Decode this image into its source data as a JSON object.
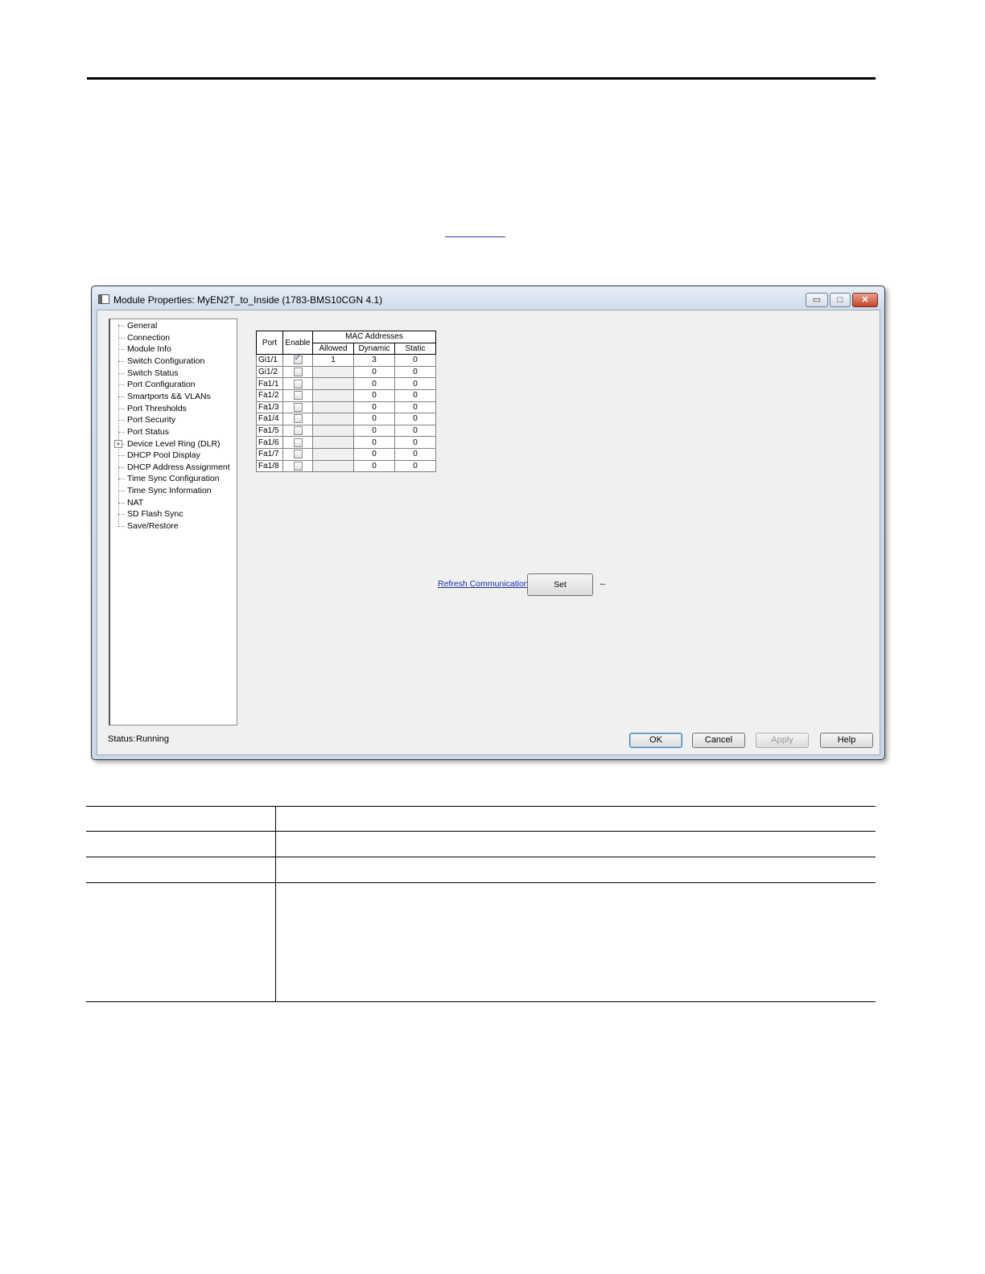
{
  "window": {
    "title": "Module Properties: MyEN2T_to_Inside (1783-BMS10CGN 4.1)",
    "controls": {
      "minimize": "▭",
      "maximize": "□",
      "close": "✕"
    }
  },
  "tree": {
    "items": [
      "General",
      "Connection",
      "Module Info",
      "Switch Configuration",
      "Switch Status",
      "Port Configuration",
      "Smartports && VLANs",
      "Port Thresholds",
      "Port Security",
      "Port Status",
      "Device Level Ring (DLR)",
      "DHCP Pool Display",
      "DHCP Address Assignment",
      "Time Sync Configuration",
      "Time Sync Information",
      "NAT",
      "SD Flash Sync",
      "Save/Restore"
    ],
    "expander": "+"
  },
  "port_table": {
    "headers": {
      "port": "Port",
      "enable": "Enable",
      "mac": "MAC Addresses",
      "allowed": "Allowed",
      "dynamic": "Dynamic",
      "static": "Static"
    },
    "rows": [
      {
        "port": "Gi1/1",
        "enabled": true,
        "allowed": "1",
        "dynamic": "3",
        "static": "0"
      },
      {
        "port": "Gi1/2",
        "enabled": false,
        "allowed": "",
        "dynamic": "0",
        "static": "0"
      },
      {
        "port": "Fa1/1",
        "enabled": false,
        "allowed": "",
        "dynamic": "0",
        "static": "0"
      },
      {
        "port": "Fa1/2",
        "enabled": false,
        "allowed": "",
        "dynamic": "0",
        "static": "0"
      },
      {
        "port": "Fa1/3",
        "enabled": false,
        "allowed": "",
        "dynamic": "0",
        "static": "0"
      },
      {
        "port": "Fa1/4",
        "enabled": false,
        "allowed": "",
        "dynamic": "0",
        "static": "0"
      },
      {
        "port": "Fa1/5",
        "enabled": false,
        "allowed": "",
        "dynamic": "0",
        "static": "0"
      },
      {
        "port": "Fa1/6",
        "enabled": false,
        "allowed": "",
        "dynamic": "0",
        "static": "0"
      },
      {
        "port": "Fa1/7",
        "enabled": false,
        "allowed": "",
        "dynamic": "0",
        "static": "0"
      },
      {
        "port": "Fa1/8",
        "enabled": false,
        "allowed": "",
        "dynamic": "0",
        "static": "0"
      }
    ]
  },
  "refresh_link": "Refresh Communication",
  "set_button": "Set",
  "arrow_icon": "←",
  "status": {
    "label": "Status:",
    "value": "Running"
  },
  "buttons": {
    "ok": "OK",
    "cancel": "Cancel",
    "apply": "Apply",
    "help": "Help"
  }
}
